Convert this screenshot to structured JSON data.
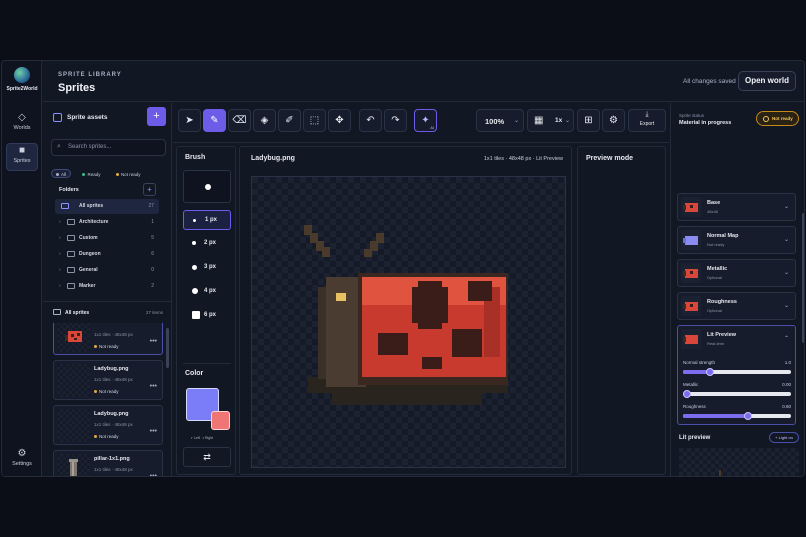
{
  "brand": {
    "name": "Sprite2World"
  },
  "rail": {
    "worlds": "Worlds",
    "sprites": "Sprites",
    "settings": "Settings"
  },
  "header": {
    "eyebrow": "SPRITE LIBRARY",
    "title": "Sprites",
    "saved": "All changes saved",
    "open_world": "Open world"
  },
  "assets": {
    "title": "Sprite assets",
    "search_placeholder": "Search sprites...",
    "filters": [
      {
        "label": "All"
      },
      {
        "label": "Ready",
        "color": "#34c37a"
      },
      {
        "label": "Not ready",
        "color": "#e6a93a"
      }
    ],
    "folders_title": "Folders",
    "folders": [
      {
        "name": "All sprites",
        "count": "27"
      },
      {
        "name": "Architecture",
        "count": "1"
      },
      {
        "name": "Custom",
        "count": "5"
      },
      {
        "name": "Dungeon",
        "count": "6"
      },
      {
        "name": "General",
        "count": "0"
      },
      {
        "name": "Marker",
        "count": "2"
      }
    ],
    "list_title": "All sprites",
    "list_count": "27 items",
    "cards": [
      {
        "name": "",
        "meta": "1x1 tiles · 48x48 px",
        "status": "Not ready"
      },
      {
        "name": "Ladybug.png",
        "meta": "1x1 tiles · 48x48 px",
        "status": "Not ready"
      },
      {
        "name": "Ladybug.png",
        "meta": "1x1 tiles · 48x48 px",
        "status": "Not ready"
      },
      {
        "name": "pillar-1x1.png",
        "meta": "1x1 tiles · 48x48 px",
        "status": ""
      }
    ]
  },
  "toolbar": {
    "zoom": "100%",
    "grid_mult": "1x",
    "export": "Export",
    "ai_sub": "AI"
  },
  "brush": {
    "title": "Brush",
    "sizes": [
      "1 px",
      "2 px",
      "3 px",
      "4 px",
      "6 px"
    ],
    "color_title": "Color",
    "primary": "#7b7cf7",
    "secondary": "#f07575",
    "left": "Left",
    "right": "Right"
  },
  "canvas": {
    "filename": "Ladybug.png",
    "info": "1x1 tiles · 48x48 px · Lit Preview"
  },
  "preview": {
    "title": "Preview mode"
  },
  "status": {
    "label": "Sprite status",
    "value": "Material in progress",
    "badge": "Not ready"
  },
  "maps": [
    {
      "name": "Base",
      "sub": "48x48"
    },
    {
      "name": "Normal Map",
      "sub": "Not ready"
    },
    {
      "name": "Metallic",
      "sub": "Optional"
    },
    {
      "name": "Roughness",
      "sub": "Optional"
    }
  ],
  "lit": {
    "name": "Lit Preview",
    "sub": "Real-time",
    "sliders": [
      {
        "label": "Normal strength",
        "value": "1.0",
        "fraction": 0.25
      },
      {
        "label": "Metallic",
        "value": "0.00",
        "fraction": 0.0
      },
      {
        "label": "Roughness",
        "value": "0.60",
        "fraction": 0.6
      }
    ]
  },
  "lit_preview": {
    "title": "Lit preview",
    "toggle": "+ Light on"
  }
}
